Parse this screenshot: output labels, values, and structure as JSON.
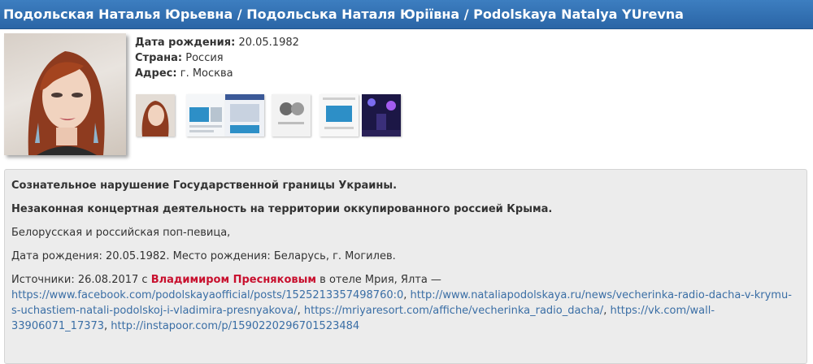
{
  "header": {
    "title": "Подольская Наталья Юрьевна / Подольська Наталя Юріївна / Podolskaya Natalya YUrevna"
  },
  "profile": {
    "photo_icon": "portrait-photo",
    "fields": [
      {
        "label": "Дата рождения:",
        "value": "20.05.1982"
      },
      {
        "label": "Страна:",
        "value": "Россия"
      },
      {
        "label": "Адрес:",
        "value": "г. Москва"
      }
    ],
    "thumbnail_count": 6
  },
  "description": {
    "heading1": "Сознательное нарушение Государственной границы Украины.",
    "heading2": "Незаконная концертная деятельность на территории оккупированного россией Крыма.",
    "line1": "Белорусская и российская поп-певица,",
    "line2": "Дата рождения: 20.05.1982. Место рождения: Беларусь, г. Могилев.",
    "sources_prefix": "Источники: 26.08.2017 с ",
    "person_name": "Владимиром Пресняковым",
    "sources_middle": " в отеле Мрия, Ялта — ",
    "links": [
      "https://www.facebook.com/podolskayaofficial/posts/1525213357498760:0",
      "http://www.nataliapodolskaya.ru/news/vecherinka-radio-dacha-v-krymu-s-uchastiem-natali-podolskoj-i-vladimira-presnyakova/",
      "https://mriyaresort.com/affiche/vecherinka_radio_dacha/",
      "https://vk.com/wall-33906071_17373",
      "http://instapoor.com/p/1590220296701523484"
    ],
    "link_separator": ", "
  },
  "colors": {
    "header_bg": "#2f6fb1",
    "link": "#3a6ea5",
    "person_link": "#c8102e"
  }
}
